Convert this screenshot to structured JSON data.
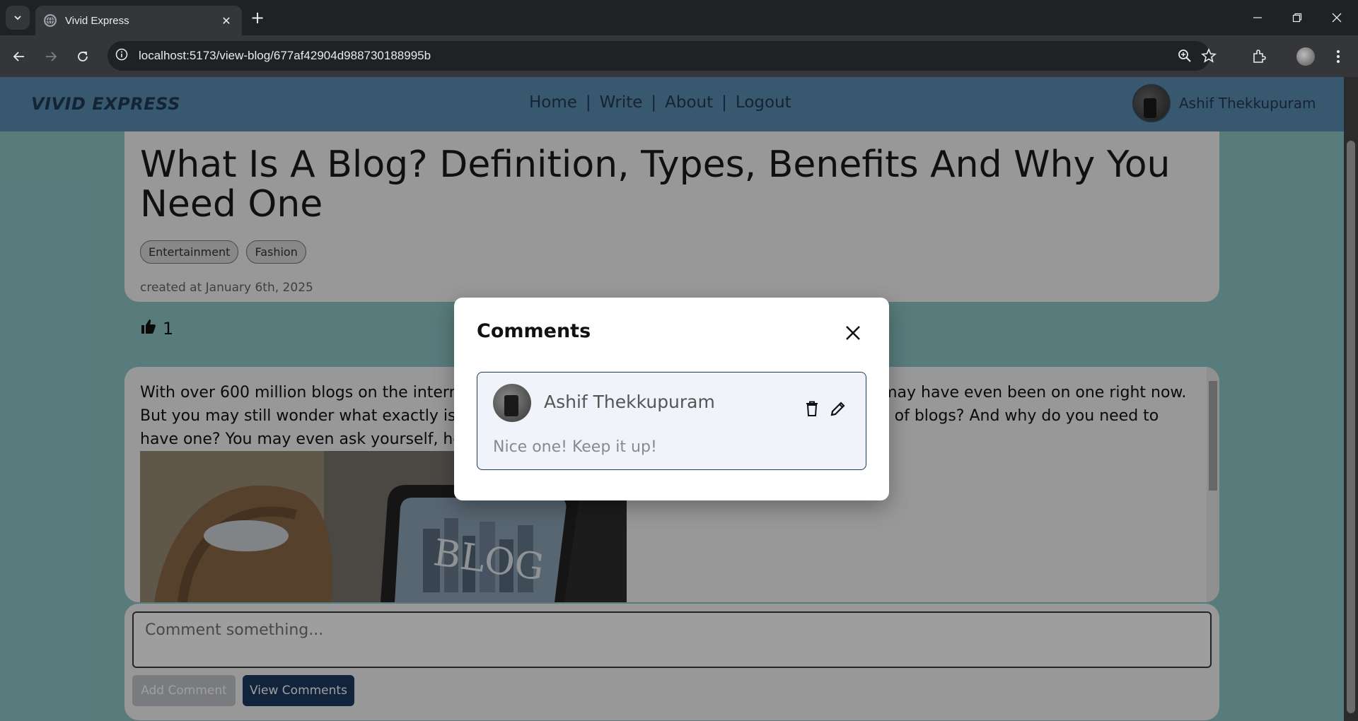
{
  "browser": {
    "tab_title": "Vivid Express",
    "url": "localhost:5173/view-blog/677af42904d988730188995b"
  },
  "nav": {
    "brand": "VIVID EXPRESS",
    "links": [
      "Home",
      "Write",
      "About",
      "Logout"
    ],
    "separator": "|",
    "user_name": "Ashif Thekkupuram"
  },
  "post": {
    "title": "What Is A Blog? Definition, Types, Benefits And Why You Need One",
    "tags": [
      "Entertainment",
      "Fashion"
    ],
    "created": "created at January 6th, 2025",
    "likes": "1",
    "body": "With over 600 million blogs on the internet, it's likely that you've come across several blogs or may have even been on one right now. But you may still wonder what exactly is a blog? How does it work? What are the different types of blogs? And why do you need to have one? You may even ask yourself, how can I start my own blog?",
    "image_text": "BLOG"
  },
  "comment_box": {
    "placeholder": "Comment something...",
    "add_label": "Add Comment",
    "view_label": "View Comments"
  },
  "modal": {
    "title": "Comments",
    "comments": [
      {
        "author": "Ashif Thekkupuram",
        "text": "Nice one! Keep it up!"
      }
    ]
  },
  "colors": {
    "page_bg": "#8ec7c9",
    "nav_bg": "#5b8fb3",
    "primary_button": "#1c3a5f"
  }
}
